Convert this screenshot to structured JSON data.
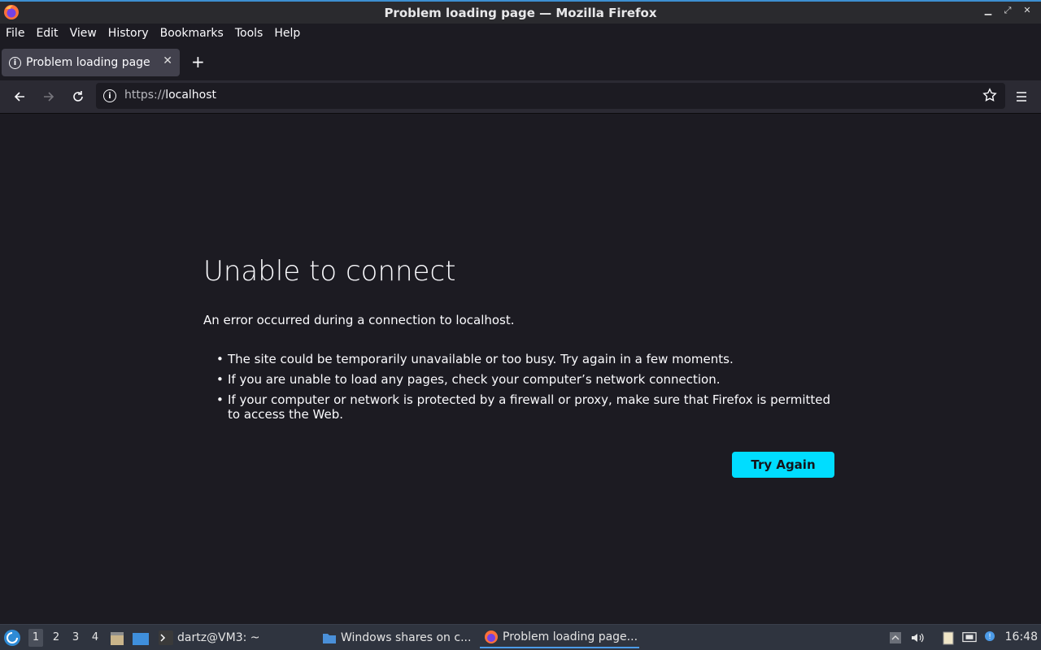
{
  "window": {
    "title": "Problem loading page — Mozilla Firefox"
  },
  "menubar": {
    "items": [
      {
        "label": "File"
      },
      {
        "label": "Edit"
      },
      {
        "label": "View"
      },
      {
        "label": "History"
      },
      {
        "label": "Bookmarks"
      },
      {
        "label": "Tools"
      },
      {
        "label": "Help"
      }
    ]
  },
  "tabs": [
    {
      "label": "Problem loading page",
      "active": true
    }
  ],
  "urlbar": {
    "scheme": "https://",
    "host": "localhost"
  },
  "error_page": {
    "title": "Unable to connect",
    "description": "An error occurred during a connection to localhost.",
    "suggestions": [
      "The site could be temporarily unavailable or too busy. Try again in a few moments.",
      "If you are unable to load any pages, check your computer’s network connection.",
      "If your computer or network is protected by a firewall or proxy, make sure that Firefox is permitted to access the Web."
    ],
    "button_label": "Try Again"
  },
  "taskbar": {
    "workspaces": [
      "1",
      "2",
      "3",
      "4"
    ],
    "active_workspace": "1",
    "apps": [
      {
        "label": "dartz@VM3: ~",
        "icon": "terminal-icon"
      },
      {
        "label": "Windows shares on c...",
        "icon": "folder-icon"
      },
      {
        "label": "Problem loading page...",
        "icon": "firefox-icon",
        "active": true
      }
    ],
    "clock": "16:48"
  },
  "colors": {
    "accent_button": "#00ddff",
    "page_background": "#1c1b22",
    "taskbar_active_indicator": "#4c9be8"
  }
}
